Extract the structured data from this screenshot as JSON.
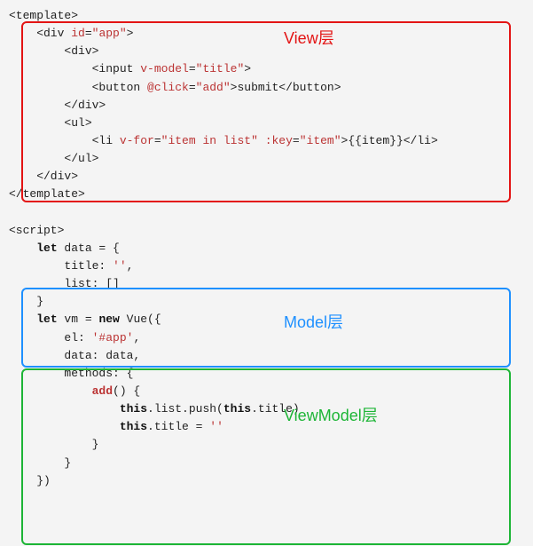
{
  "code": {
    "line1": "<template>",
    "line2a": "    <div ",
    "line2_attr": "id",
    "line2_eq": "=",
    "line2_val": "\"app\"",
    "line2b": ">",
    "line3": "        <div>",
    "line4a": "            <input ",
    "line4_attr": "v-model",
    "line4_eq": "=",
    "line4_val": "\"title\"",
    "line4b": ">",
    "line5a": "            <button ",
    "line5_attr": "@click",
    "line5_eq": "=",
    "line5_val": "\"add\"",
    "line5b": ">submit</button>",
    "line6": "        </div>",
    "line7": "        <ul>",
    "line8a": "            <li ",
    "line8_attr1": "v-for",
    "line8_eq1": "=",
    "line8_val1": "\"item in list\"",
    "line8_sp": " ",
    "line8_attr2": ":key",
    "line8_eq2": "=",
    "line8_val2": "\"item\"",
    "line8b": ">{{item}}</li>",
    "line9": "        </ul>",
    "line10": "    </div>",
    "line11": "</template>",
    "line12": "",
    "line13": "<script>",
    "line14a": "    ",
    "line14_kw": "let",
    "line14b": " data = {",
    "line15a": "        title: ",
    "line15_str": "''",
    "line15b": ",",
    "line16": "        list: []",
    "line17": "    }",
    "line18a": "    ",
    "line18_kw": "let",
    "line18b": " vm = ",
    "line18_kw2": "new",
    "line18c": " Vue({",
    "line19a": "        el: ",
    "line19_str": "'#app'",
    "line19b": ",",
    "line20": "        data: data,",
    "line21": "        methods: {",
    "line22a": "            ",
    "line22_fn": "add",
    "line22b": "() {",
    "line23a": "                ",
    "line23_kw": "this",
    "line23b": ".list.push(",
    "line23_kw2": "this",
    "line23c": ".title)",
    "line24a": "                ",
    "line24_kw": "this",
    "line24b": ".title = ",
    "line24_str": "''",
    "line25": "            }",
    "line26": "        }",
    "line27": "    })"
  },
  "labels": {
    "view": "View层",
    "model": "Model层",
    "viewmodel": "ViewModel层"
  }
}
